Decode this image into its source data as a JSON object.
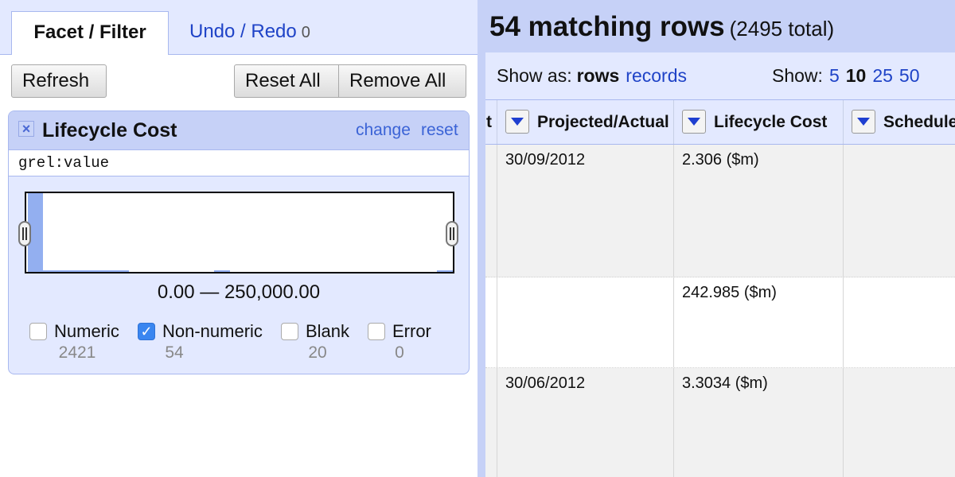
{
  "left_panel": {
    "tabs": [
      {
        "label": "Facet / Filter"
      },
      {
        "label": "Undo / Redo",
        "count": "0"
      }
    ],
    "buttons": {
      "refresh": "Refresh",
      "reset_all": "Reset All",
      "remove_all": "Remove All"
    },
    "facet": {
      "close_icon": "×",
      "title": "Lifecycle Cost",
      "change": "change",
      "reset": "reset",
      "expression": "grel:value",
      "range": "0.00 — 250,000.00",
      "choices": [
        {
          "label": "Numeric",
          "count": "2421",
          "checked": false
        },
        {
          "label": "Non-numeric",
          "count": "54",
          "checked": true
        },
        {
          "label": "Blank",
          "count": "20",
          "checked": false
        },
        {
          "label": "Error",
          "count": "0",
          "checked": false
        }
      ]
    }
  },
  "right_panel": {
    "summary": {
      "matching": "54 matching rows",
      "total": "(2495 total)"
    },
    "show_as": {
      "label": "Show as:",
      "current": "rows",
      "alternative": "records"
    },
    "show": {
      "label": "Show:",
      "options": [
        "5",
        "10",
        "25",
        "50"
      ],
      "current": "10"
    },
    "columns": [
      {
        "label": "t"
      },
      {
        "label": "Projected/Actual"
      },
      {
        "label": "Lifecycle Cost"
      },
      {
        "label": "Schedule"
      }
    ],
    "rows": [
      {
        "projected_actual": "30/09/2012",
        "lifecycle_cost": "2.306 ($m)"
      },
      {
        "projected_actual": "",
        "lifecycle_cost": "242.985 ($m)"
      },
      {
        "projected_actual": "30/06/2012",
        "lifecycle_cost": "3.3034 ($m)"
      }
    ]
  }
}
